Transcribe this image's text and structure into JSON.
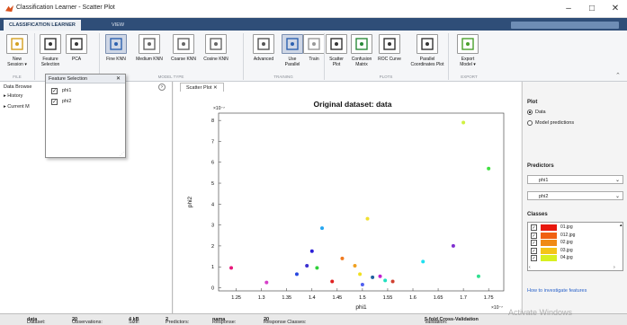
{
  "window": {
    "title": "Classification Learner - Scatter Plot",
    "min": "–",
    "max": "□",
    "close": "✕"
  },
  "tabs": [
    {
      "label": "CLASSIFICATION LEARNER"
    },
    {
      "label": "VIEW"
    }
  ],
  "ribbon": {
    "buttons": [
      {
        "label": "New\nSession ▾"
      },
      {
        "label": "Feature\nSelection"
      },
      {
        "label": "PCA"
      },
      {
        "label": "Fine KNN"
      },
      {
        "label": "Medium KNN"
      },
      {
        "label": "Coarse KNN"
      },
      {
        "label": "Cosine KNN"
      },
      {
        "label": "Advanced"
      },
      {
        "label": "Use\nParallel"
      },
      {
        "label": "Train"
      },
      {
        "label": "Scatter\nPlot"
      },
      {
        "label": "Confusion\nMatrix"
      },
      {
        "label": "ROC Curve"
      },
      {
        "label": "Parallel\nCoordinates Plot"
      },
      {
        "label": "Export\nModel ▾"
      }
    ],
    "groups": [
      "FILE",
      "FEATURES",
      "MODEL TYPE",
      "TRAINING",
      "PLOTS",
      "EXPORT"
    ]
  },
  "left_panel": {
    "data_browser": "Data Browse",
    "history": "History",
    "current_model": "Current M"
  },
  "feature_selection": {
    "title": "Feature Selection",
    "close": "✕",
    "items": [
      {
        "label": "phi1",
        "checked": true
      },
      {
        "label": "phi2",
        "checked": true
      }
    ]
  },
  "plot_tab": {
    "label": "Scatter Plot",
    "close": "✕"
  },
  "chart_data": {
    "type": "scatter",
    "title": "Original dataset: data",
    "xlabel": "phi1",
    "ylabel": "phi2",
    "x_exponent": "×10⁻⁷",
    "y_exponent": "×10⁻⁷",
    "xlim": [
      1.215,
      1.78
    ],
    "ylim": [
      -0.15,
      8.35
    ],
    "xticks": [
      "1.25",
      "1.3",
      "1.35",
      "1.4",
      "1.45",
      "1.5",
      "1.55",
      "1.6",
      "1.65",
      "1.7",
      "1.75"
    ],
    "yticks": [
      "0",
      "1",
      "2",
      "3",
      "4",
      "5",
      "6",
      "7",
      "8"
    ],
    "points": [
      {
        "x": 1.24,
        "y": 0.95,
        "color": "#e8197b"
      },
      {
        "x": 1.31,
        "y": 0.25,
        "color": "#d63fc9"
      },
      {
        "x": 1.37,
        "y": 0.65,
        "color": "#2848e0"
      },
      {
        "x": 1.39,
        "y": 1.05,
        "color": "#3b2fd0"
      },
      {
        "x": 1.4,
        "y": 1.75,
        "color": "#2b1fd8"
      },
      {
        "x": 1.41,
        "y": 0.95,
        "color": "#2fd13a"
      },
      {
        "x": 1.42,
        "y": 2.85,
        "color": "#25a6f0"
      },
      {
        "x": 1.44,
        "y": 0.3,
        "color": "#e02020"
      },
      {
        "x": 1.46,
        "y": 1.4,
        "color": "#f07a20"
      },
      {
        "x": 1.485,
        "y": 1.05,
        "color": "#f0a020"
      },
      {
        "x": 1.495,
        "y": 0.65,
        "color": "#f0e020"
      },
      {
        "x": 1.5,
        "y": 0.15,
        "color": "#5060f0"
      },
      {
        "x": 1.51,
        "y": 3.3,
        "color": "#f0e030"
      },
      {
        "x": 1.52,
        "y": 0.5,
        "color": "#2060a0"
      },
      {
        "x": 1.535,
        "y": 0.55,
        "color": "#c020d0"
      },
      {
        "x": 1.545,
        "y": 0.35,
        "color": "#20e0c0"
      },
      {
        "x": 1.56,
        "y": 0.3,
        "color": "#d04030"
      },
      {
        "x": 1.62,
        "y": 1.25,
        "color": "#20e0f0"
      },
      {
        "x": 1.68,
        "y": 2.0,
        "color": "#8030d0"
      },
      {
        "x": 1.7,
        "y": 7.9,
        "color": "#d0f040"
      },
      {
        "x": 1.73,
        "y": 0.55,
        "color": "#30e090"
      },
      {
        "x": 1.75,
        "y": 5.7,
        "color": "#40e040"
      }
    ]
  },
  "right_panel": {
    "plot_heading": "Plot",
    "data_option": "Data",
    "model_option": "Model predictions",
    "predictors_heading": "Predictors",
    "x_label": "X:",
    "x_value": "phi1",
    "y_label": "Y:",
    "y_value": "phi2",
    "classes_heading": "Classes",
    "classes": [
      {
        "name": "01.jpg",
        "color": "#e8160c"
      },
      {
        "name": "012.jpg",
        "color": "#f06010"
      },
      {
        "name": "02.jpg",
        "color": "#f08a14"
      },
      {
        "name": "03.jpg",
        "color": "#f5c418"
      },
      {
        "name": "04.jpg",
        "color": "#d8f020"
      }
    ],
    "link": "How to investigate features"
  },
  "status": {
    "dataset_label": "Dataset:",
    "dataset": "data",
    "observations_label": "Observations:",
    "observations": "20",
    "size_label": "Size:",
    "size": "4 kB",
    "predictors_label": "Predictors:",
    "predictors": "2",
    "response_label": "Response:",
    "response": "nama",
    "response_classes_label": "Response Classes:",
    "response_classes": "20",
    "validation_label": "Validation:",
    "validation": "5-fold Cross-Validation"
  },
  "watermark": "Activate Windows"
}
